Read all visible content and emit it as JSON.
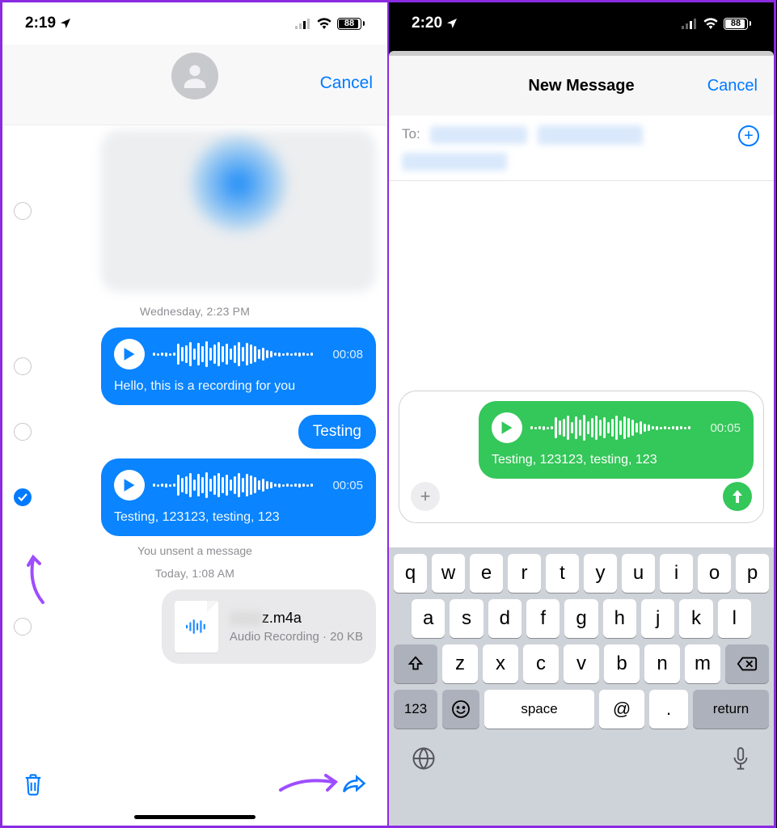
{
  "left": {
    "status": {
      "time": "2:19",
      "battery": "88"
    },
    "nav": {
      "cancel": "Cancel"
    },
    "timestamp1": "Wednesday, 2:23 PM",
    "voice1": {
      "duration": "00:08",
      "caption": "Hello, this is a recording for you"
    },
    "text1": "Testing",
    "voice2": {
      "duration": "00:05",
      "caption": "Testing, 123123, testing, 123"
    },
    "unsent": "You unsent a message",
    "timestamp2": "Today, 1:08 AM",
    "file": {
      "name": "z.m4a",
      "meta": "Audio Recording · 20 KB"
    }
  },
  "right": {
    "status": {
      "time": "2:20",
      "battery": "88"
    },
    "nav": {
      "title": "New Message",
      "cancel": "Cancel"
    },
    "to_label": "To:",
    "voice": {
      "duration": "00:05",
      "caption": "Testing, 123123, testing, 123"
    },
    "keyboard": {
      "row1": [
        "q",
        "w",
        "e",
        "r",
        "t",
        "y",
        "u",
        "i",
        "o",
        "p"
      ],
      "row2": [
        "a",
        "s",
        "d",
        "f",
        "g",
        "h",
        "j",
        "k",
        "l"
      ],
      "row3": [
        "z",
        "x",
        "c",
        "v",
        "b",
        "n",
        "m"
      ],
      "k123": "123",
      "space": "space",
      "at": "@",
      "dot": ".",
      "return": "return"
    }
  }
}
